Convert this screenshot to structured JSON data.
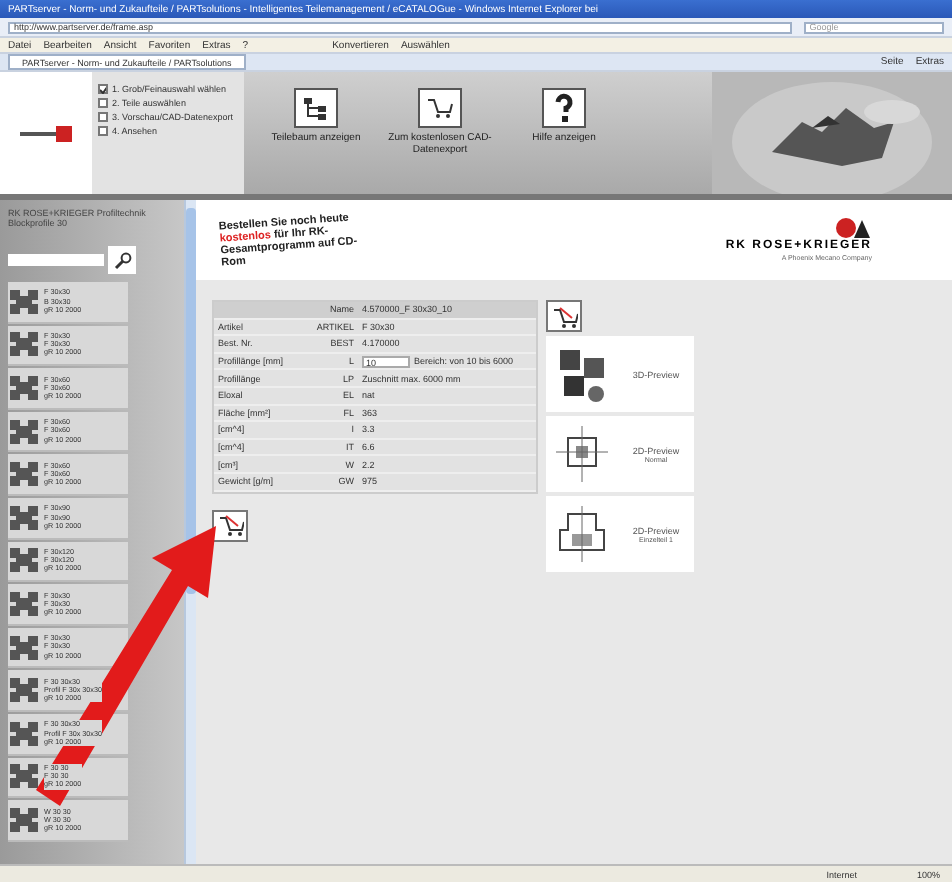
{
  "window": {
    "title": "PARTserver - Norm- und Zukaufteile / PARTsolutions - Intelligentes Teilemanagement / eCATALOGue - Windows Internet Explorer bei"
  },
  "address_bar": {
    "url": "http://www.partserver.de/frame.asp",
    "search_placeholder": "Google"
  },
  "menu": [
    "Datei",
    "Bearbeiten",
    "Ansicht",
    "Favoriten",
    "Extras",
    "?"
  ],
  "links_bar": [
    "Konvertieren",
    "Auswählen"
  ],
  "tab": {
    "label": "PARTserver - Norm- und Zukaufteile / PARTsolutions"
  },
  "command_bar": [
    "Seite",
    "Extras"
  ],
  "header": {
    "steps": [
      {
        "label": "1. Grob/Feinauswahl wählen",
        "checked": true
      },
      {
        "label": "2. Teile auswählen",
        "checked": false
      },
      {
        "label": "3. Vorschau/CAD-Datenexport",
        "checked": false
      },
      {
        "label": "4. Ansehen",
        "checked": false
      }
    ],
    "buttons": [
      {
        "kind": "tree",
        "label": "Teilebaum anzeigen"
      },
      {
        "kind": "cart",
        "label": "Zum kostenlosen CAD-Datenexport"
      },
      {
        "kind": "help",
        "label": "Hilfe anzeigen"
      }
    ]
  },
  "sidebar": {
    "title": "RK ROSE+KRIEGER Profiltechnik Blockprofile 30",
    "items": [
      {
        "lines": [
          "F 30x30",
          "B 30x30",
          "gR 10 2000"
        ]
      },
      {
        "lines": [
          "F 30x30",
          "F 30x30",
          "gR 10 2000"
        ]
      },
      {
        "lines": [
          "F 30x60",
          "F 30x60",
          "gR 10 2000"
        ]
      },
      {
        "lines": [
          "F 30x60",
          "F 30x60",
          "gR 10 2000"
        ]
      },
      {
        "lines": [
          "F 30x60",
          "F 30x60",
          "gR 10 2000"
        ]
      },
      {
        "lines": [
          "F 30x90",
          "F 30x90",
          "gR 10 2000"
        ]
      },
      {
        "lines": [
          "F 30x120",
          "F 30x120",
          "gR 10 2000"
        ]
      },
      {
        "lines": [
          "F 30x30",
          "F 30x30",
          "gR 10 2000"
        ]
      },
      {
        "lines": [
          "F 30x30",
          "F 30x30",
          "gR 10 2000"
        ]
      },
      {
        "lines": [
          "F 30 30x30",
          "Profil F 30x 30x30",
          "gR 10 2000"
        ]
      },
      {
        "lines": [
          "F 30 30x30",
          "Profil F 30x 30x30",
          "gR 10 2000"
        ]
      },
      {
        "lines": [
          "F 30 30",
          "F 30 30",
          "gR 10 2000"
        ]
      },
      {
        "lines": [
          "W 30 30",
          "W 30 30",
          "gR 10 2000"
        ]
      }
    ]
  },
  "banner": {
    "text": "Bestellen Sie noch heute **kostenlos** für Ihr RK-Gesamtprogramm auf CD-Rom",
    "brand": "RK ROSE+KRIEGER",
    "brand_sub": "A Phoenix Mecano Company"
  },
  "table": {
    "title_label": "Name",
    "title_value": "4.570000_F 30x30_10",
    "rows": [
      {
        "kind": "text",
        "label": "Artikel",
        "code": "ARTIKEL",
        "value": "F 30x30"
      },
      {
        "kind": "text",
        "label": "Best. Nr.",
        "code": "BEST",
        "value": "4.170000"
      },
      {
        "kind": "input",
        "label": "Profillänge [mm]",
        "code": "L",
        "value": "10",
        "note": "Bereich: von 10 bis 6000"
      },
      {
        "kind": "text",
        "label": "Profillänge",
        "code": "LP",
        "value": "Zuschnitt max. 6000 mm"
      },
      {
        "kind": "text",
        "label": "Eloxal",
        "code": "EL",
        "value": "nat"
      },
      {
        "kind": "text",
        "label": "Fläche [mm²]",
        "code": "FL",
        "value": "363"
      },
      {
        "kind": "text",
        "label": "[cm^4]",
        "code": "I",
        "value": "3.3"
      },
      {
        "kind": "text",
        "label": "[cm^4]",
        "code": "IT",
        "value": "6.6"
      },
      {
        "kind": "text",
        "label": "[cm³]",
        "code": "W",
        "value": "2.2"
      },
      {
        "kind": "text",
        "label": "Gewicht [g/m]",
        "code": "GW",
        "value": "975"
      }
    ]
  },
  "previews": [
    {
      "kind": "solid",
      "label": "3D-Preview"
    },
    {
      "kind": "plan",
      "label": "2D-Preview",
      "sub": "Normal"
    },
    {
      "kind": "section",
      "label": "2D-Preview",
      "sub": "Einzelteil 1"
    }
  ],
  "status_bar": {
    "zone": "Internet",
    "zoom": "100%"
  }
}
